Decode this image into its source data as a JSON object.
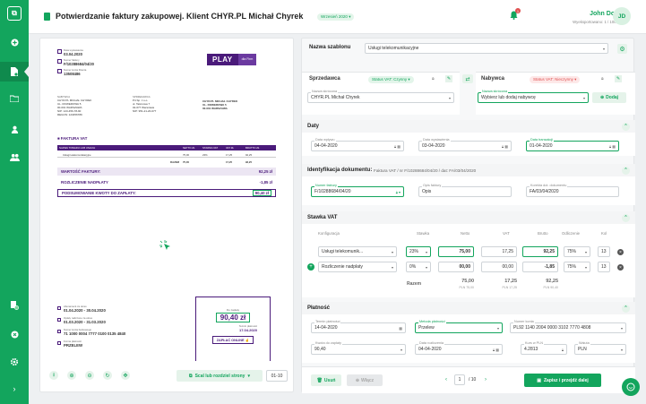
{
  "header": {
    "title": "Potwierdzanie faktury zakupowej. Klient CHYR.PL Michał Chyrek",
    "badge": "Wrzesień 2020",
    "badge_arrow": "▾",
    "bell_count": "1",
    "user_name": "John Doe",
    "user_sub": "Wyeksportowano: 1 / 1000",
    "avatar": "JD"
  },
  "sidebar": {
    "items": [
      {
        "icon": "plus-circle-icon"
      },
      {
        "icon": "document-icon"
      },
      {
        "icon": "folder-icon"
      },
      {
        "icon": "user-icon"
      },
      {
        "icon": "users-icon"
      },
      {
        "icon": "document-check-icon"
      },
      {
        "icon": "close-circle-icon"
      },
      {
        "icon": "gear-icon"
      },
      {
        "icon": "chevron-right-icon"
      }
    ]
  },
  "invoice": {
    "meta": [
      {
        "label": "Data wystawienia",
        "value": "03.04.2020"
      },
      {
        "label": "Numer faktury",
        "value": "F/10288684/04/20"
      },
      {
        "label": "Numer konta Klienta",
        "value": "13508486"
      }
    ],
    "logo": "PLAY",
    "logo_badge": "dla Firm",
    "sprzedawca_h": "NABYWCA",
    "sprzedawca_lines": [
      "CHYR.PL MICHAŁ CHYREK",
      "UL. ROWEROWA 5",
      "00-001 WARSZAWA",
      "NIP: 123-456-78-90",
      "REGON: 123456789"
    ],
    "nabywca_h": "SPRZEDAWCA",
    "nabywca_lines": [
      "P4 Sp. z o.o.",
      "ul. Taśmowa 7",
      "02-677 Warszawa",
      "NIP: 951-21-20-077"
    ],
    "odbiorca_lines": [
      "CHYR.PL MICHAŁ CHYREK",
      "UL. ROWEROWA 5",
      "00-001 WARSZAWA"
    ],
    "faktura_vat": "FAKTURA VAT",
    "table_headers": [
      "NAZWA TOWARU LUB USŁUGI",
      "NETTO ZŁ",
      "STAWKA VAT",
      "VAT ZŁ",
      "BRUTTO ZŁ"
    ],
    "table_row": [
      "Usługi telekomunikacyjne",
      "75,00",
      "23%",
      "17,25",
      "92,25"
    ],
    "table_total": [
      "RAZEM",
      "75,00",
      "",
      "17,25",
      "92,25"
    ],
    "wartosc_label": "WARTOŚĆ FAKTURY:",
    "wartosc_value": "92,25 zł",
    "rozliczenie_label": "ROZLICZENIE NADPŁATY",
    "rozliczenie_value": "-1,85 zł",
    "podsumowanie_label": "PODSUMOWANIE KWOTY DO ZAPŁATY:",
    "podsumowanie_value": "90,40 zł",
    "bottom": [
      {
        "label": "Abonament za okres",
        "value": "01.04.2020 - 30.04.2020"
      },
      {
        "label": "Opłaty naliczone za okres",
        "value": "01.03.2020 - 31.03.2020"
      },
      {
        "label": "Numer konta bankowego",
        "value": "71 1000 0004 7777 0100 0135 4840"
      },
      {
        "label": "Forma płatności",
        "value": "PRZELEW"
      }
    ],
    "pay_label": "Do zapłaty",
    "pay_amount": "90,40 zł",
    "pay_date_label": "Termin płatności",
    "pay_date": "17.04.2020",
    "pay_online": "ZAPŁAĆ ONLINE"
  },
  "viewer_toolbar": {
    "merge_label": "Scal lub rozdziel strony",
    "page_range": "01-10"
  },
  "form": {
    "template_label": "Nazwa szablonu",
    "template_value": "Usługi telekomunikacyjne",
    "seller": {
      "title": "Sprzedawca",
      "status": "Status VAT: Czynny",
      "field_label": "Nazwa skrócona",
      "field_value": "CHYR.PL Michał Chyrek"
    },
    "buyer": {
      "title": "Nabywca",
      "status": "Status VAT: Nieczynny",
      "field_label": "Nazwa skrócona",
      "field_value": "Wybierz lub dodaj nabywcę",
      "add": "Dodaj"
    },
    "dates": {
      "title": "Daty",
      "fields": [
        {
          "label": "Data wpływu",
          "value": "04-04-2020"
        },
        {
          "label": "Data wystawienia",
          "value": "03-04-2020"
        },
        {
          "label": "Data transakcji",
          "value": "01-04-2020"
        }
      ]
    },
    "ident": {
      "title": "Identyfikacja dokumentu:",
      "subtitle": "Faktura VAT / nr F/10288684/04/20 / dat: FA/03/04/2020",
      "fields": [
        {
          "label": "Numer faktury",
          "value": "F/10288684/04/20"
        },
        {
          "label": "Opis faktury",
          "value": "Opis"
        },
        {
          "label": "Korekta dot. dokumentu",
          "value": "FA/03/04/2020"
        }
      ]
    },
    "vat": {
      "title": "Stawka VAT",
      "headers": [
        "Konfiguracja",
        "Stawka",
        "Netto",
        "VAT",
        "Brutto",
        "Odliczenie",
        "Kol"
      ],
      "rows": [
        {
          "config": "Usługi telekomunik...",
          "rate": "23%",
          "netto": "75,00",
          "vat": "17,25",
          "brutto": "92,25",
          "odl": "75%",
          "kol": "13"
        },
        {
          "config": "Rozliczenie nadpłaty",
          "rate": "0%",
          "netto": "00,00",
          "vat": "00,00",
          "brutto": "-1,85",
          "odl": "75%",
          "kol": "13"
        }
      ],
      "total_label": "Razem",
      "total_netto": "75,00",
      "total_netto_sub": "PLN 75,00",
      "total_vat": "17,25",
      "total_vat_sub": "PLN 17,25",
      "total_brutto": "92,25",
      "total_brutto_sub": "PLN 90,40"
    },
    "payment": {
      "title": "Płatność",
      "fields": [
        {
          "label": "Termin płatności",
          "value": "14-04-2020"
        },
        {
          "label": "Metoda płatności",
          "value": "Przelew"
        },
        {
          "label": "Numer konta",
          "value": "PL92 1140 2004 0000 3102 7770 4808"
        },
        {
          "label": "Kwota do zapłaty",
          "value": "90,40"
        },
        {
          "label": "Data rozliczenia",
          "value": "04-04-2020"
        },
        {
          "label": "Kurs w PLN",
          "value": "4.2813"
        },
        {
          "label": "Waluta",
          "value": "PLN"
        }
      ]
    },
    "footer": {
      "delete": "Usuń",
      "merge": "Włącz",
      "page_current": "1",
      "page_total": "/ 10",
      "save": "Zapisz i przejdź dalej"
    }
  },
  "colors": {
    "green": "#13a55d",
    "purple": "#4a1a7a",
    "red": "#e05050"
  }
}
